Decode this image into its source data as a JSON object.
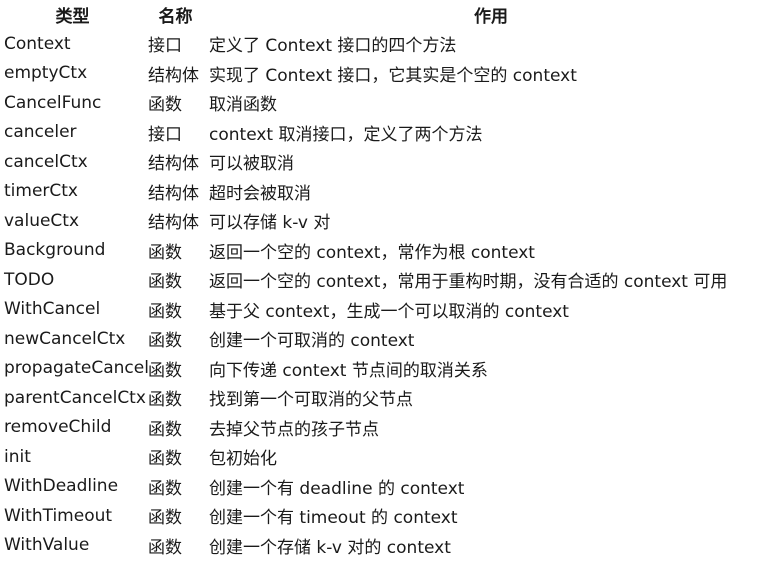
{
  "header": {
    "type": "类型",
    "name": "名称",
    "desc": "作用"
  },
  "rows": [
    {
      "type": "Context",
      "name": "接口",
      "desc": "定义了 Context 接口的四个方法"
    },
    {
      "type": "emptyCtx",
      "name": "结构体",
      "desc": "实现了 Context 接口，它其实是个空的 context"
    },
    {
      "type": "CancelFunc",
      "name": "函数",
      "desc": "取消函数"
    },
    {
      "type": "canceler",
      "name": "接口",
      "desc": "context 取消接口，定义了两个方法"
    },
    {
      "type": "cancelCtx",
      "name": "结构体",
      "desc": "可以被取消"
    },
    {
      "type": "timerCtx",
      "name": "结构体",
      "desc": "超时会被取消"
    },
    {
      "type": "valueCtx",
      "name": "结构体",
      "desc": "可以存储 k-v 对"
    },
    {
      "type": "Background",
      "name": "函数",
      "desc": "返回一个空的 context，常作为根 context"
    },
    {
      "type": "TODO",
      "name": "函数",
      "desc": "返回一个空的 context，常用于重构时期，没有合适的 context 可用"
    },
    {
      "type": "WithCancel",
      "name": "函数",
      "desc": "基于父 context，生成一个可以取消的 context"
    },
    {
      "type": "newCancelCtx",
      "name": "函数",
      "desc": "创建一个可取消的 context"
    },
    {
      "type": "propagateCancel",
      "name": "函数",
      "desc": "向下传递 context 节点间的取消关系"
    },
    {
      "type": "parentCancelCtx",
      "name": "函数",
      "desc": "找到第一个可取消的父节点"
    },
    {
      "type": "removeChild",
      "name": "函数",
      "desc": "去掉父节点的孩子节点"
    },
    {
      "type": "init",
      "name": "函数",
      "desc": "包初始化"
    },
    {
      "type": "WithDeadline",
      "name": "函数",
      "desc": "创建一个有 deadline 的 context"
    },
    {
      "type": "WithTimeout",
      "name": "函数",
      "desc": "创建一个有 timeout 的 context"
    },
    {
      "type": "WithValue",
      "name": "函数",
      "desc": "创建一个存储 k-v 对的 context"
    }
  ]
}
